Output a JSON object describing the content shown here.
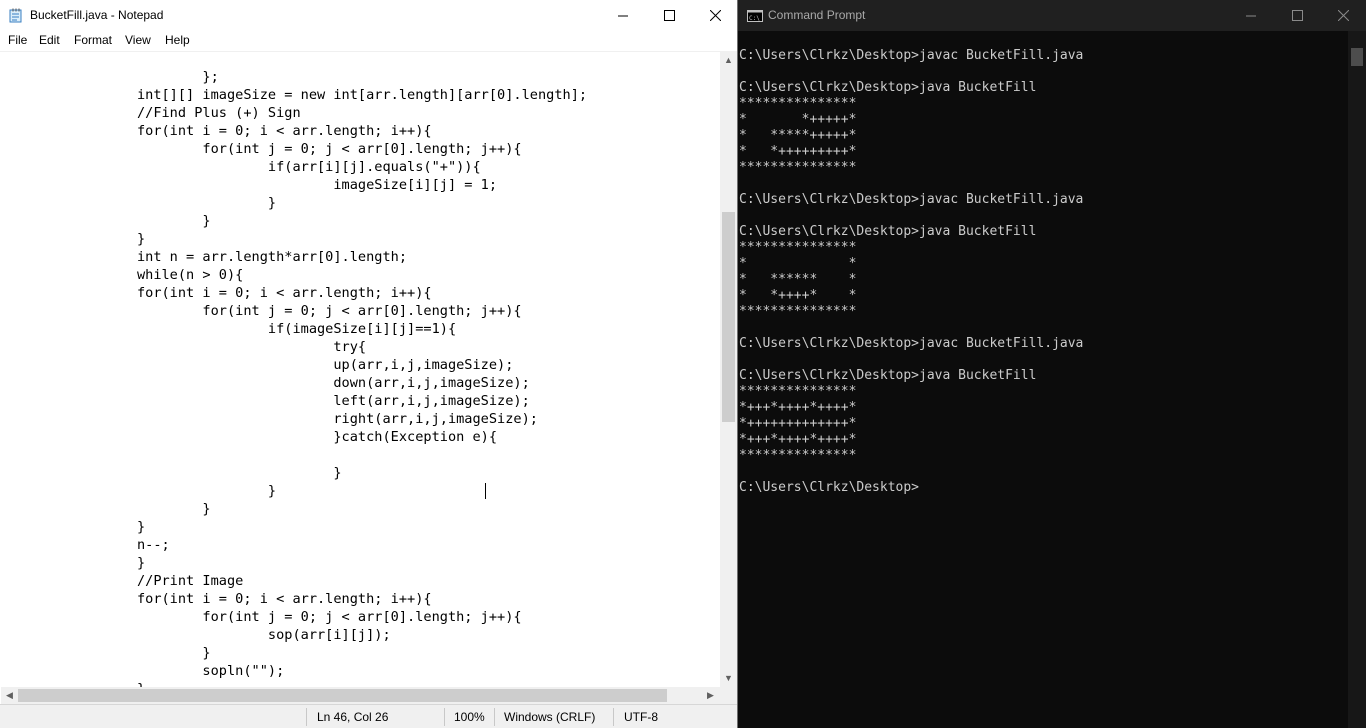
{
  "notepad": {
    "title": "BucketFill.java - Notepad",
    "menu": [
      "File",
      "Edit",
      "Format",
      "View",
      "Help"
    ],
    "code_lines": [
      "                        };",
      "                int[][] imageSize = new int[arr.length][arr[0].length];",
      "                //Find Plus (+) Sign",
      "                for(int i = 0; i < arr.length; i++){",
      "                        for(int j = 0; j < arr[0].length; j++){",
      "                                if(arr[i][j].equals(\"+\")){",
      "                                        imageSize[i][j] = 1;",
      "                                }",
      "                        }",
      "                }",
      "                int n = arr.length*arr[0].length;",
      "                while(n > 0){",
      "                for(int i = 0; i < arr.length; i++){",
      "                        for(int j = 0; j < arr[0].length; j++){",
      "                                if(imageSize[i][j]==1){",
      "                                        try{",
      "                                        up(arr,i,j,imageSize);",
      "                                        down(arr,i,j,imageSize);",
      "                                        left(arr,i,j,imageSize);",
      "                                        right(arr,i,j,imageSize);",
      "                                        }catch(Exception e){",
      "",
      "                                        }",
      "                                }",
      "                        }",
      "                }",
      "                n--;",
      "                }",
      "                //Print Image",
      "                for(int i = 0; i < arr.length; i++){",
      "                        for(int j = 0; j < arr[0].length; j++){",
      "                                sop(arr[i][j]);",
      "                        }",
      "                        sopln(\"\");",
      "                }"
    ],
    "status": {
      "position": "Ln 46, Col 26",
      "zoom": "100%",
      "line_endings": "Windows (CRLF)",
      "encoding": "UTF-8"
    }
  },
  "cmd": {
    "title": "Command Prompt",
    "lines": [
      "C:\\Users\\Clrkz\\Desktop>javac BucketFill.java",
      "",
      "C:\\Users\\Clrkz\\Desktop>java BucketFill",
      "***************",
      "*       *+++++*",
      "*   *****+++++*",
      "*   *+++++++++*",
      "***************",
      "",
      "C:\\Users\\Clrkz\\Desktop>javac BucketFill.java",
      "",
      "C:\\Users\\Clrkz\\Desktop>java BucketFill",
      "***************",
      "*             *",
      "*   ******    *",
      "*   *++++*    *",
      "***************",
      "",
      "C:\\Users\\Clrkz\\Desktop>javac BucketFill.java",
      "",
      "C:\\Users\\Clrkz\\Desktop>java BucketFill",
      "***************",
      "*+++*++++*++++*",
      "*+++++++++++++*",
      "*+++*++++*++++*",
      "***************",
      "",
      "C:\\Users\\Clrkz\\Desktop>"
    ]
  }
}
